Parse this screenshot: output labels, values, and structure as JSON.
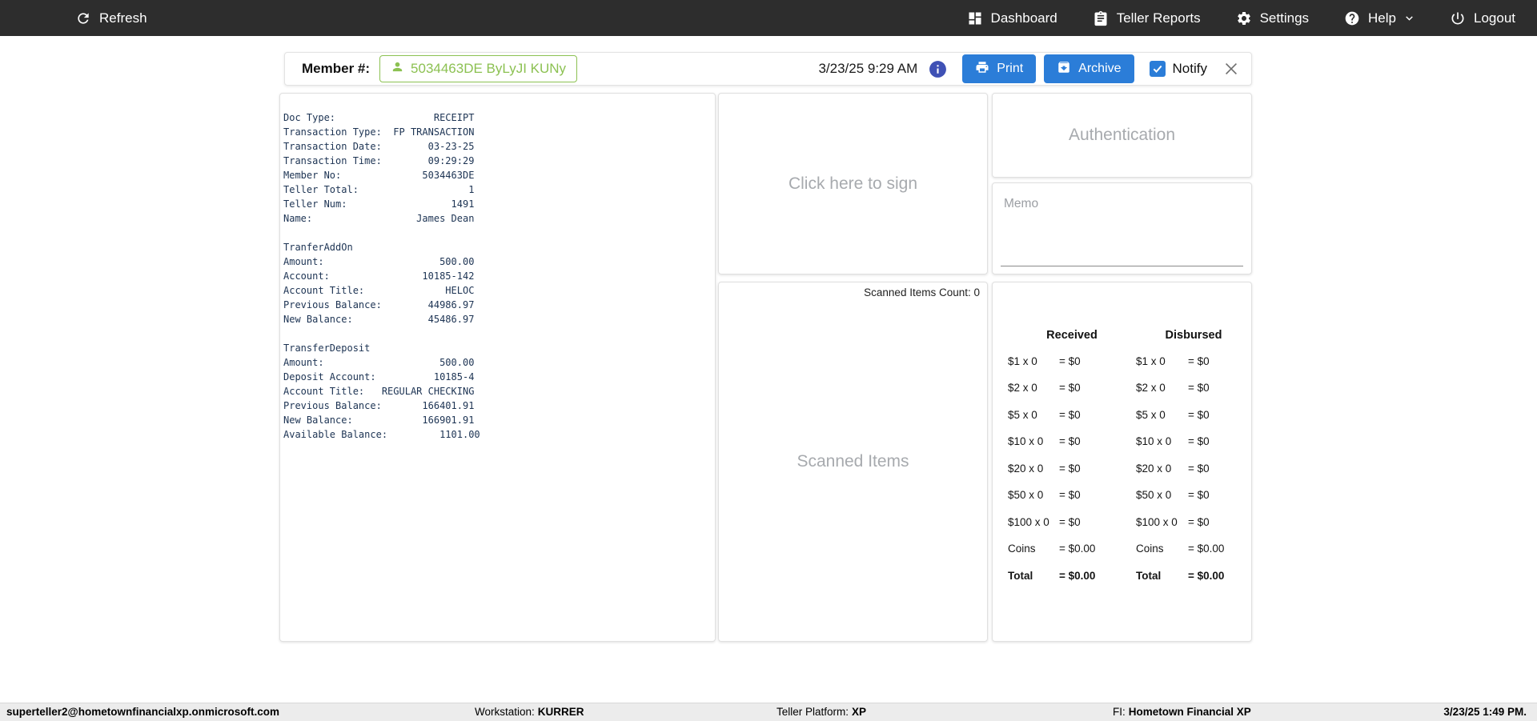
{
  "navbar": {
    "refresh_label": "Refresh",
    "items": [
      {
        "label": "Dashboard"
      },
      {
        "label": "Teller Reports"
      },
      {
        "label": "Settings"
      },
      {
        "label": "Help"
      },
      {
        "label": "Logout"
      }
    ]
  },
  "member_bar": {
    "label": "Member #:",
    "member_chip": "5034463DE ByLyJI KUNy",
    "datetime": "3/23/25 9:29 AM",
    "print_label": "Print",
    "archive_label": "Archive",
    "notify_label": "Notify",
    "notify_checked": true
  },
  "receipt": {
    "lines": [
      "Doc Type:                 RECEIPT",
      "Transaction Type:  FP TRANSACTION",
      "Transaction Date:        03-23-25",
      "Transaction Time:        09:29:29",
      "Member No:              5034463DE",
      "Teller Total:                   1",
      "Teller Num:                  1491",
      "Name:                  James Dean",
      "",
      "TranferAddOn",
      "Amount:                    500.00",
      "Account:                10185-142",
      "Account Title:              HELOC",
      "Previous Balance:        44986.97",
      "New Balance:             45486.97",
      "",
      "TransferDeposit",
      "Amount:                    500.00",
      "Deposit Account:          10185-4",
      "Account Title:   REGULAR CHECKING",
      "Previous Balance:       166401.91",
      "New Balance:            166901.91",
      "Available Balance:         1101.00"
    ]
  },
  "signature_panel": {
    "placeholder": "Click here to sign"
  },
  "scanned_panel": {
    "count_label": "Scanned Items Count: 0",
    "placeholder": "Scanned Items"
  },
  "auth_panel": {
    "placeholder": "Authentication"
  },
  "memo_panel": {
    "label": "Memo",
    "value": ""
  },
  "cash_count": {
    "received_header": "Received",
    "disbursed_header": "Disbursed",
    "rows": [
      {
        "denom": "$1 x 0",
        "received": "= $0",
        "disbursed": "= $0",
        "bold": false
      },
      {
        "denom": "$2 x 0",
        "received": "= $0",
        "disbursed": "= $0",
        "bold": false
      },
      {
        "denom": "$5 x 0",
        "received": "= $0",
        "disbursed": "= $0",
        "bold": false
      },
      {
        "denom": "$10 x 0",
        "received": "= $0",
        "disbursed": "= $0",
        "bold": false
      },
      {
        "denom": "$20 x 0",
        "received": "= $0",
        "disbursed": "= $0",
        "bold": false
      },
      {
        "denom": "$50 x 0",
        "received": "= $0",
        "disbursed": "= $0",
        "bold": false
      },
      {
        "denom": "$100 x 0",
        "received": "= $0",
        "disbursed": "= $0",
        "bold": false
      },
      {
        "denom": "Coins",
        "received": "= $0.00",
        "disbursed": "= $0.00",
        "bold": false
      },
      {
        "denom": "Total",
        "received": "= $0.00",
        "disbursed": "= $0.00",
        "bold": true
      }
    ]
  },
  "status_bar": {
    "email": "superteller2@hometownfinancialxp.onmicrosoft.com",
    "workstation_label": "Workstation:",
    "workstation_value": "KURRER",
    "platform_label": "Teller Platform:",
    "platform_value": "XP",
    "fi_label": "FI:",
    "fi_value": "Hometown Financial XP",
    "datetime": "3/23/25 1:49 PM."
  },
  "colors": {
    "navbar_bg": "#2d2d2d",
    "primary_blue": "#2b7dd8",
    "info_indigo": "#3f51b5",
    "member_green": "#8cc152",
    "placeholder_gray": "#a7aaae",
    "receipt_text": "#1c3353",
    "status_bg": "#ececec"
  }
}
